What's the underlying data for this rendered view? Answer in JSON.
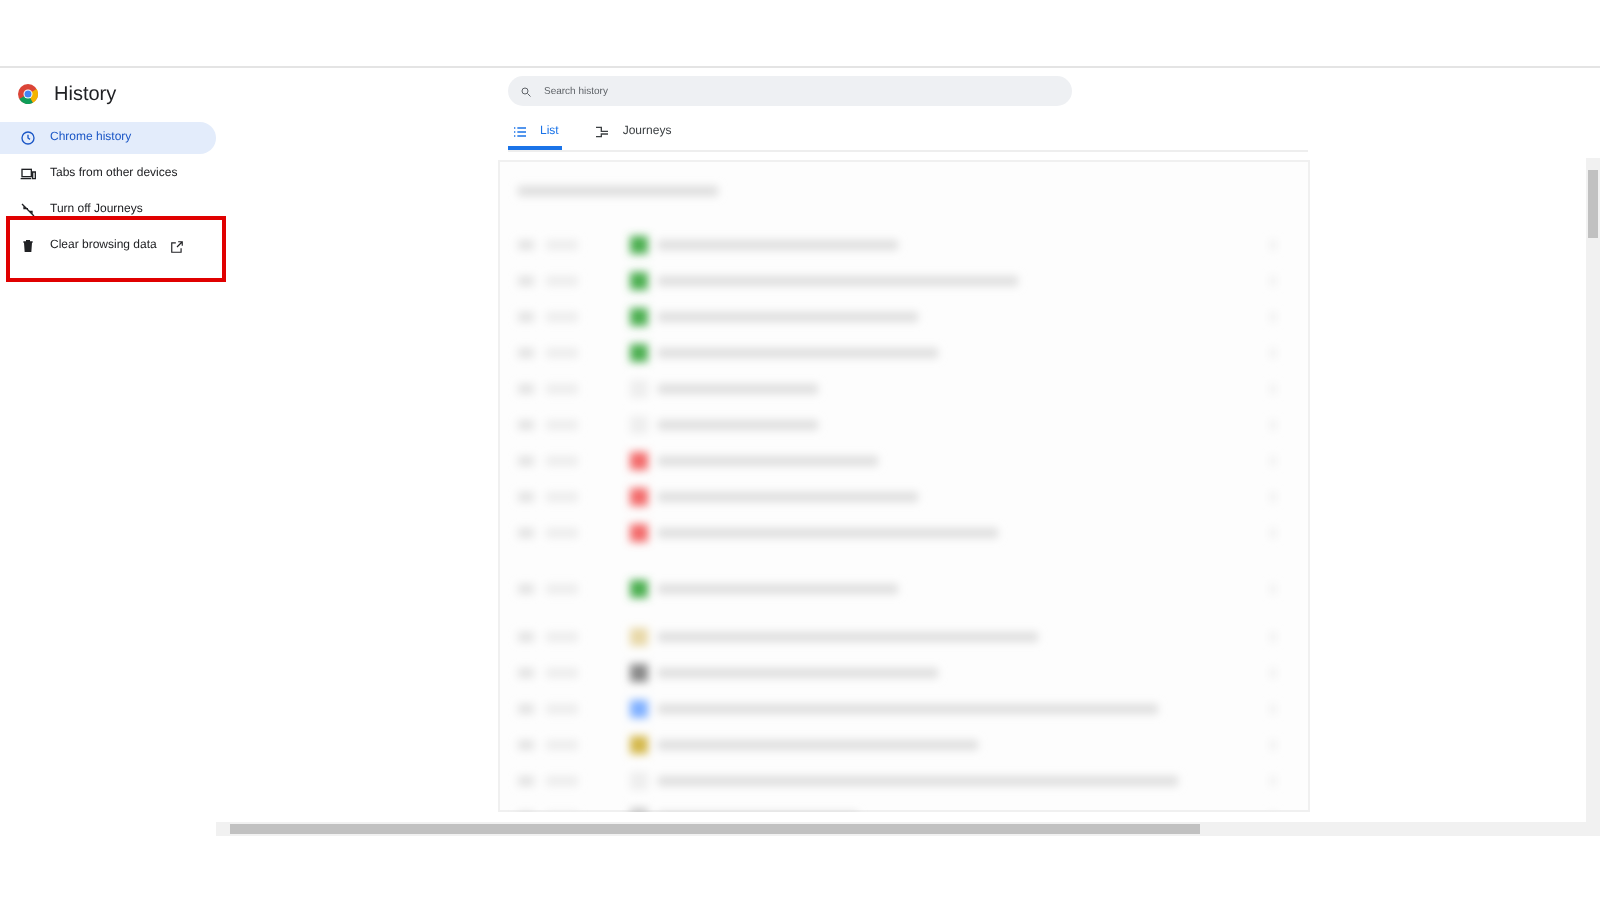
{
  "app": {
    "title": "History"
  },
  "sidebar": {
    "items": [
      {
        "label": "Chrome history",
        "kind": "clock",
        "selected": true,
        "external": false
      },
      {
        "label": "Tabs from other devices",
        "kind": "devices",
        "selected": false,
        "external": false
      },
      {
        "label": "Turn off Journeys",
        "kind": "journeys-off",
        "selected": false,
        "external": false
      },
      {
        "label": "Clear browsing data",
        "kind": "trash",
        "selected": false,
        "external": true,
        "highlighted": true
      }
    ]
  },
  "search": {
    "placeholder": "Search history"
  },
  "tabs": [
    {
      "label": "List",
      "kind": "list",
      "selected": true
    },
    {
      "label": "Journeys",
      "kind": "journeys",
      "selected": false
    }
  ]
}
